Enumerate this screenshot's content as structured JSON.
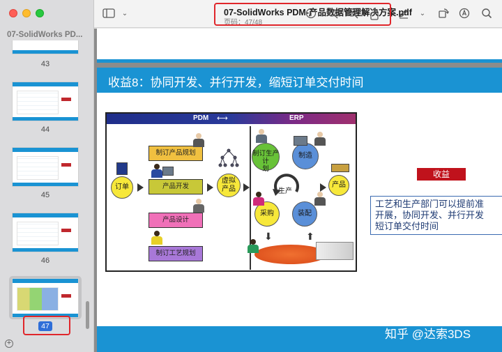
{
  "window": {
    "doc_title": "07-SolidWorks PDM-产品数据管理解决方案.pdf",
    "page_indicator": "页码：47/48",
    "sidebar_title": "07-SolidWorks PD..."
  },
  "thumbnails": [
    {
      "page": "43"
    },
    {
      "page": "44"
    },
    {
      "page": "45"
    },
    {
      "page": "46"
    },
    {
      "page": "47",
      "selected": true
    }
  ],
  "slide": {
    "title": "收益8：协同开发、并行开发，缩短订单交付时间",
    "benefit_label": "收益",
    "benefit_text_lines": [
      "工艺和生产部门可以提前准",
      "开展，协同开发、并行开发",
      "短订单交付时间"
    ]
  },
  "diagram": {
    "pdm_label": "PDM",
    "erp_label": "ERP",
    "order": "订单",
    "plan_product": "制订产品规划",
    "product_dev": "产品开发",
    "product_design": "产品设计",
    "process_plan": "制订工艺规划",
    "virtual_product_1": "虚拟",
    "virtual_product_2": "产品",
    "prod_plan_1": "制订生产计",
    "prod_plan_2": "划",
    "manufacture": "制造",
    "production": "生产",
    "product": "产品",
    "purchase": "采购",
    "assembly": "装配"
  },
  "watermark": "知乎 @达索3DS",
  "colors": {
    "accent_blue": "#1a93d3",
    "highlight_red": "#e0262b",
    "benefit_red": "#c0121c",
    "box_gold": "#f0c040",
    "box_olive": "#c8c838",
    "box_pink": "#f070b8",
    "box_purple": "#a878d8",
    "circle_yellow": "#f7e83a",
    "circle_green": "#68c238",
    "circle_blue": "#5a8fd8"
  },
  "icons": [
    "sidebar-toggle-icon",
    "info-icon",
    "zoom-out-icon",
    "zoom-in-icon",
    "share-icon",
    "markup-pen-icon",
    "chevron-down-icon",
    "rotate-icon",
    "annotate-icon",
    "search-icon",
    "add-icon"
  ]
}
